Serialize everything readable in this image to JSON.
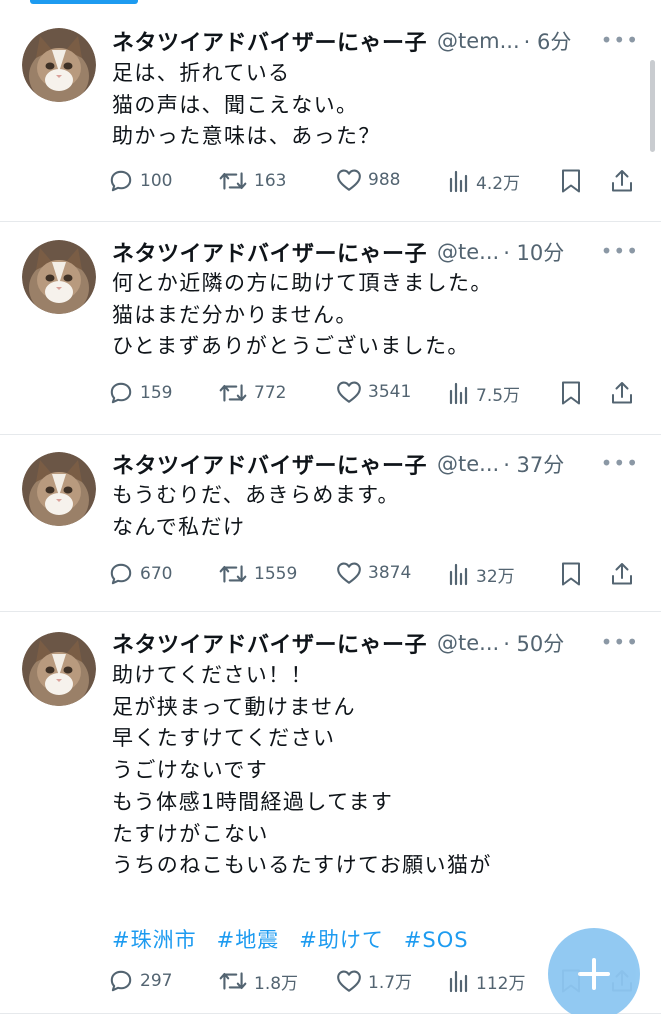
{
  "tweets": [
    {
      "name": "ネタツイアドバイザーにゃー子",
      "handle": "@tem...",
      "time": "· 6分",
      "lines": [
        "足は、折れている",
        "猫の声は、聞こえない。",
        "助かった意味は、あった？"
      ],
      "hashtags": [],
      "replies": "100",
      "retweets": "163",
      "likes": "988",
      "views": "4.2万"
    },
    {
      "name": "ネタツイアドバイザーにゃー子",
      "handle": "@te...",
      "time": "· 10分",
      "lines": [
        "何とか近隣の方に助けて頂きました。",
        "猫はまだ分かりません。",
        "ひとまずありがとうございました。"
      ],
      "hashtags": [],
      "replies": "159",
      "retweets": "772",
      "likes": "3541",
      "views": "7.5万"
    },
    {
      "name": "ネタツイアドバイザーにゃー子",
      "handle": "@te...",
      "time": "· 37分",
      "lines": [
        "もうむりだ、あきらめます。",
        "なんで私だけ"
      ],
      "hashtags": [],
      "replies": "670",
      "retweets": "1559",
      "likes": "3874",
      "views": "32万"
    },
    {
      "name": "ネタツイアドバイザーにゃー子",
      "handle": "@te...",
      "time": "· 50分",
      "lines": [
        "助けてください！！",
        "足が挟まって動けません",
        "早くたすけてください",
        "うごけないです",
        "もう体感1時間経過してます",
        "たすけがこない",
        "うちのねこもいるたすけてお願い猫が"
      ],
      "hashtags": [
        "#珠洲市",
        "#地震",
        "#助けて",
        "#SOS"
      ],
      "replies": "297",
      "retweets": "1.8万",
      "likes": "1.7万",
      "views": "112万"
    }
  ],
  "icons": {
    "more": "more-dots-icon",
    "reply": "reply-icon",
    "retweet": "retweet-icon",
    "like": "heart-icon",
    "views": "views-chart-icon",
    "bookmark": "bookmark-icon",
    "share": "share-icon",
    "compose": "compose-plus-icon"
  },
  "colors": {
    "accent": "#1d9bf0",
    "muted": "#536471",
    "text": "#0f1419"
  }
}
